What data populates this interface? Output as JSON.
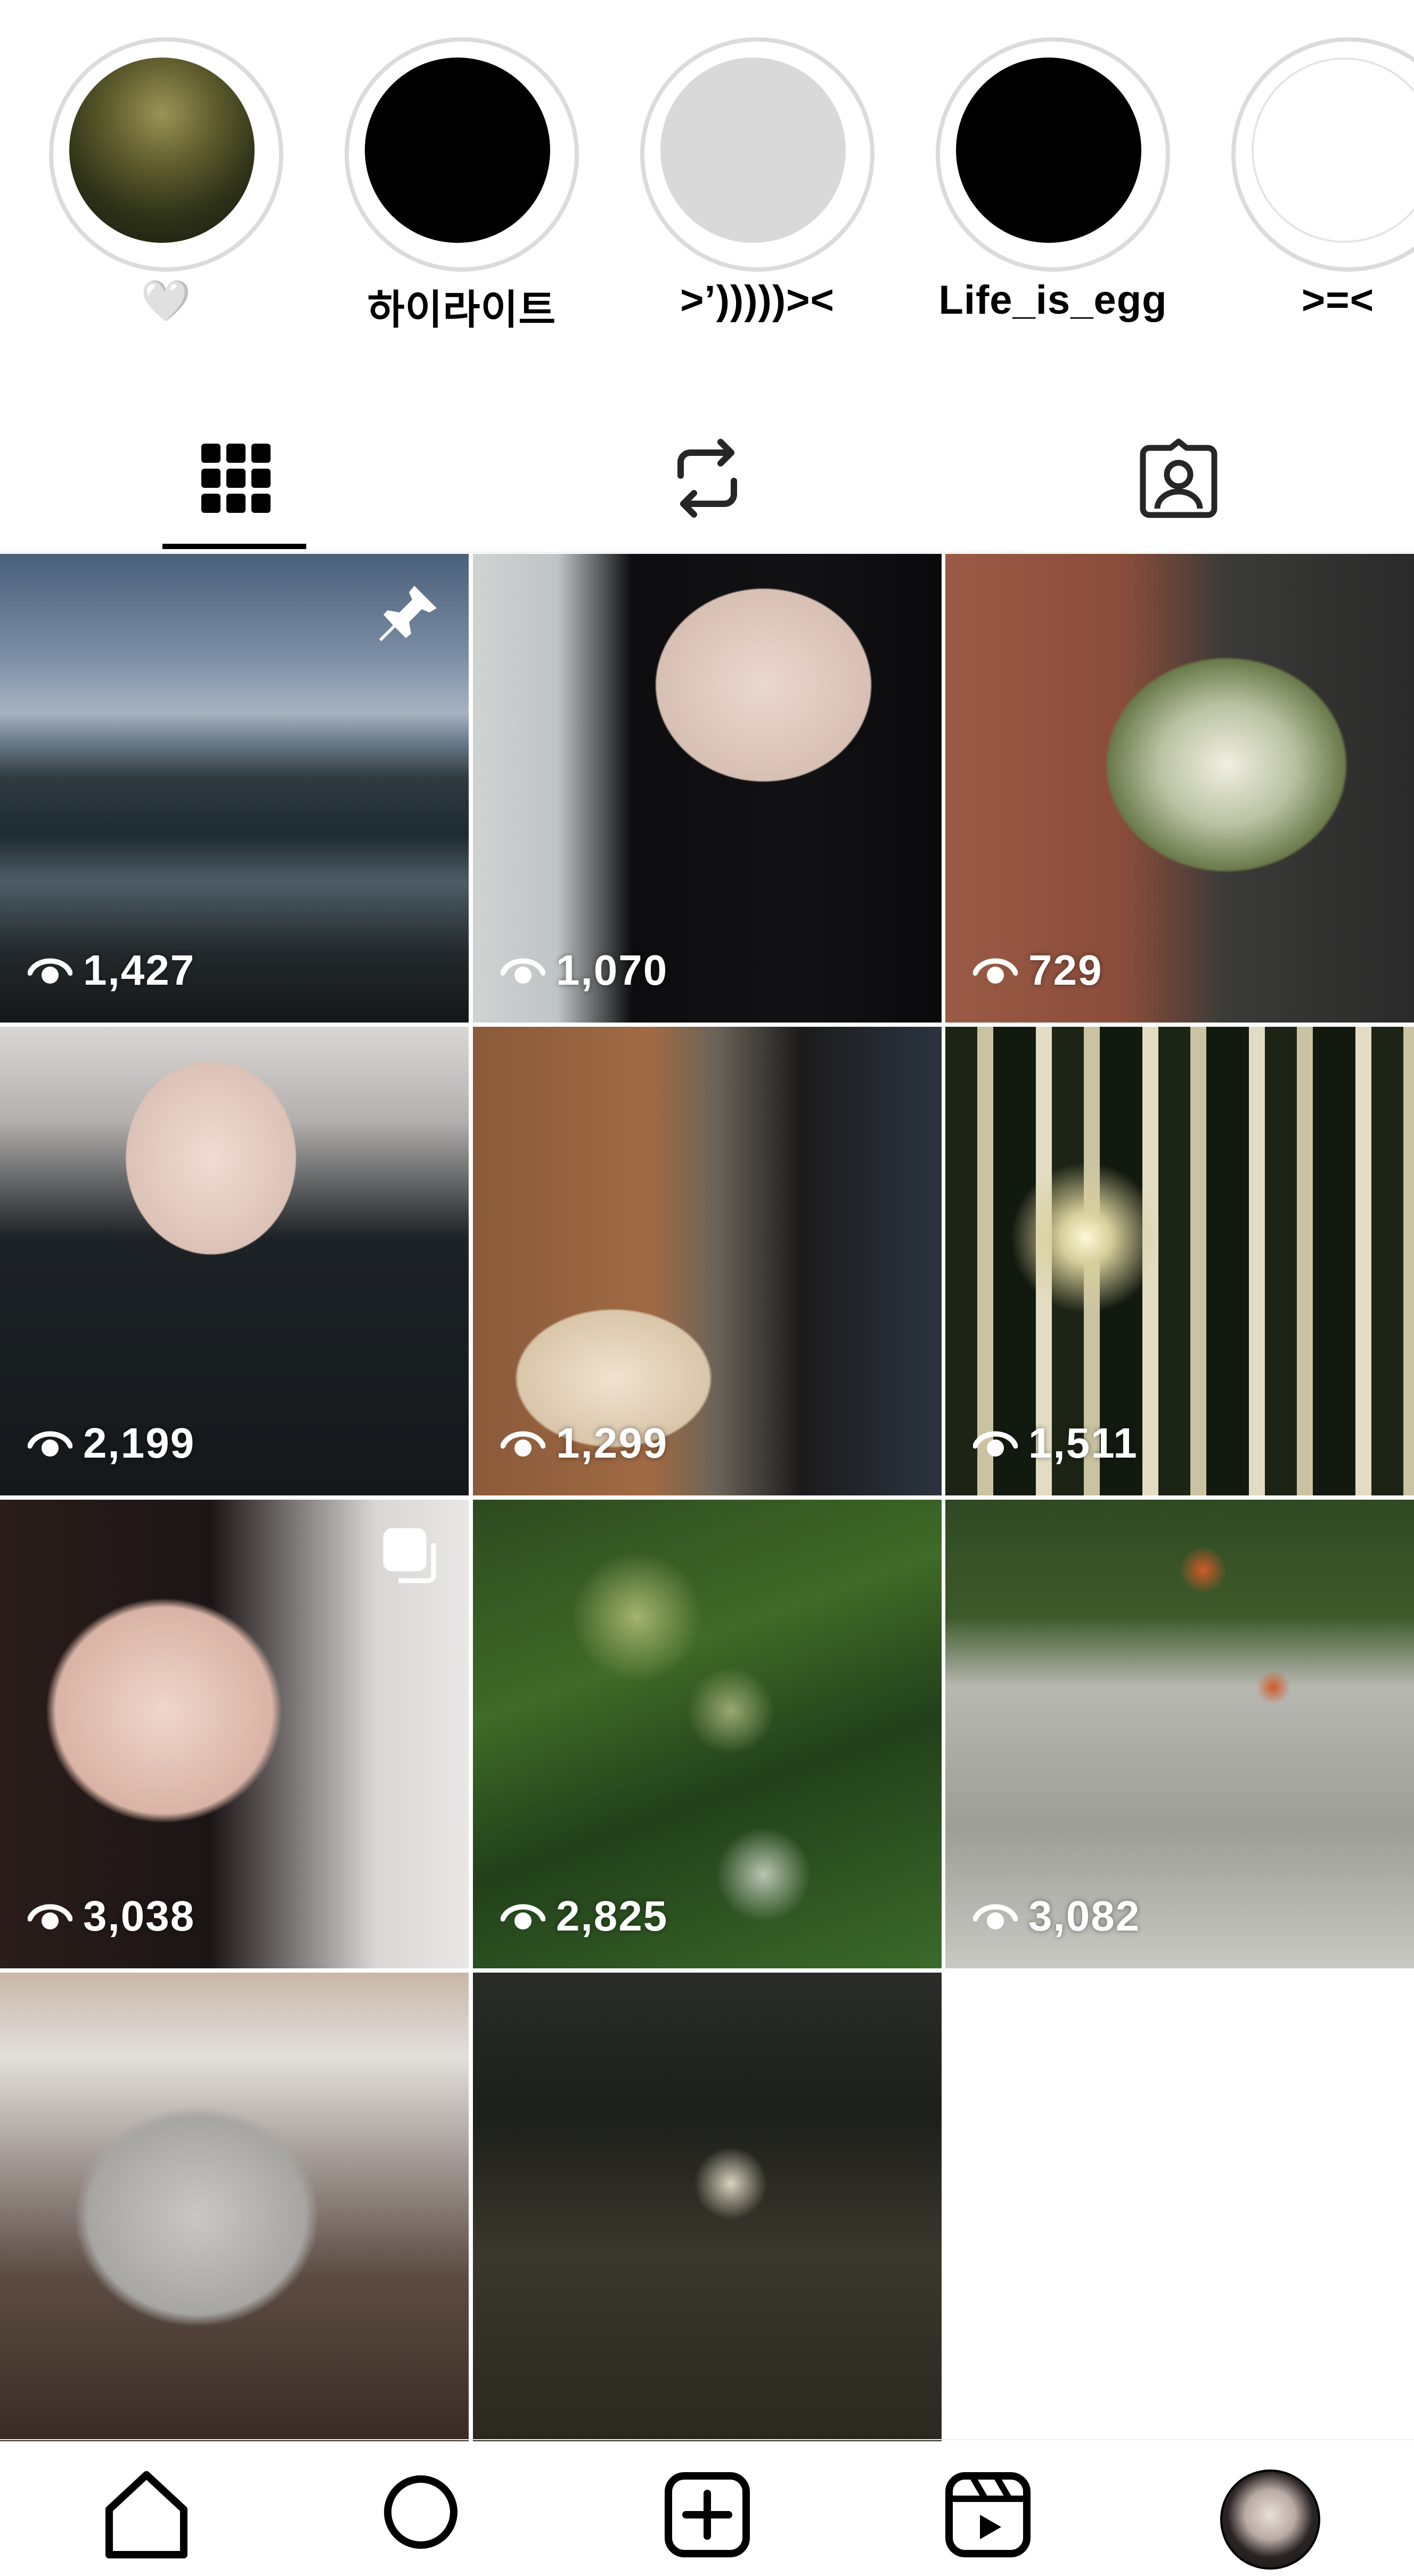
{
  "highlights": [
    {
      "label": "🤍",
      "style": "moss"
    },
    {
      "label": "하이라이트",
      "style": "black"
    },
    {
      "label": ">’)))))><",
      "style": "grey"
    },
    {
      "label": "Life_is_egg",
      "style": "black"
    },
    {
      "label": ">=<",
      "style": "white"
    }
  ],
  "tabs": [
    {
      "name": "posts-grid",
      "icon": "grid-icon",
      "active": true
    },
    {
      "name": "reposts",
      "icon": "repost-icon",
      "active": false
    },
    {
      "name": "tagged",
      "icon": "tagged-person-icon",
      "active": false
    }
  ],
  "posts": [
    {
      "views": "1,427",
      "badge": "pin-icon",
      "image": "sea-rocks"
    },
    {
      "views": "1,070",
      "badge": "",
      "image": "selfie-dark-hair"
    },
    {
      "views": "729",
      "badge": "",
      "image": "flower-bouquet"
    },
    {
      "views": "2,199",
      "badge": "",
      "image": "selfie-black-jacket"
    },
    {
      "views": "1,299",
      "badge": "",
      "image": "sheep-mirror"
    },
    {
      "views": "1,511",
      "badge": "",
      "image": "hanging-vines-lights"
    },
    {
      "views": "3,038",
      "badge": "carousel-icon",
      "image": "selfie-tongue"
    },
    {
      "views": "2,825",
      "badge": "",
      "image": "lily-pond"
    },
    {
      "views": "3,082",
      "badge": "",
      "image": "ivy-wall-flowers"
    },
    {
      "views": "",
      "badge": "",
      "image": "persian-cat"
    },
    {
      "views": "",
      "badge": "",
      "image": "dark-field"
    }
  ],
  "bottom_nav": [
    {
      "name": "home",
      "icon": "home-icon"
    },
    {
      "name": "search",
      "icon": "search-icon"
    },
    {
      "name": "create",
      "icon": "plus-square-icon"
    },
    {
      "name": "reels",
      "icon": "reels-icon"
    },
    {
      "name": "profile",
      "icon": "profile-avatar"
    }
  ]
}
